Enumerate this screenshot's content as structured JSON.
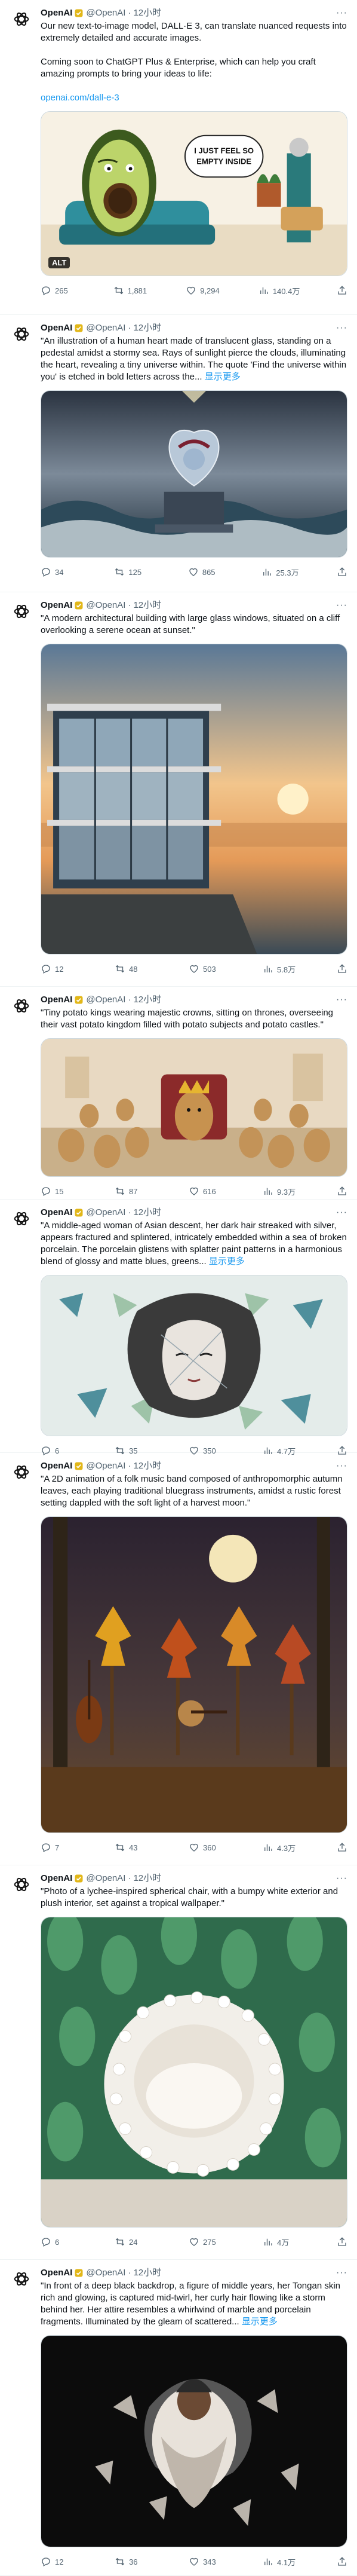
{
  "colors": {
    "accent": "#1d9bf0",
    "text_primary": "#0f1419",
    "text_secondary": "#536471",
    "border": "#eff3f4"
  },
  "tweets": [
    {
      "name": "OpenAI",
      "handle": "@OpenAI",
      "dot": "·",
      "time": "12小时",
      "more": "···",
      "paragraphs": [
        "Our new text-to-image model, DALL·E 3, can translate nuanced requests into extremely detailed and accurate images.",
        "Coming soon to ChatGPT Plus & Enterprise, which can help you craft amazing prompts to bring your ideas to life:"
      ],
      "link": "openai.com/dall-e-3",
      "image_alt": "ALT",
      "image_text": "I JUST FEEL SO EMPTY INSIDE",
      "stats": {
        "replies": "265",
        "retweets": "1,881",
        "likes": "9,294",
        "views": "140.4万"
      }
    },
    {
      "name": "OpenAI",
      "handle": "@OpenAI",
      "dot": "·",
      "time": "12小时",
      "more": "···",
      "quote": "\"An illustration of a human heart made of translucent glass, standing on a pedestal amidst a stormy sea. Rays of sunlight pierce the clouds, illuminating the heart, revealing a tiny universe within. The quote 'Find the universe within you' is etched in bold letters across the...",
      "showmore": "显示更多",
      "stats": {
        "replies": "34",
        "retweets": "125",
        "likes": "865",
        "views": "25.3万"
      }
    },
    {
      "name": "OpenAI",
      "handle": "@OpenAI",
      "dot": "·",
      "time": "12小时",
      "more": "···",
      "quote": "\"A modern architectural building with large glass windows, situated on a cliff overlooking a serene ocean at sunset.\"",
      "stats": {
        "replies": "12",
        "retweets": "48",
        "likes": "503",
        "views": "5.8万"
      }
    },
    {
      "name": "OpenAI",
      "handle": "@OpenAI",
      "dot": "·",
      "time": "12小时",
      "more": "···",
      "quote": "\"Tiny potato kings wearing majestic crowns, sitting on thrones, overseeing their vast potato kingdom filled with potato subjects and potato castles.\"",
      "stats": {
        "replies": "15",
        "retweets": "87",
        "likes": "616",
        "views": "9.3万"
      }
    },
    {
      "name": "OpenAI",
      "handle": "@OpenAI",
      "dot": "·",
      "time": "12小时",
      "more": "···",
      "quote": "\"A middle-aged woman of Asian descent, her dark hair streaked with silver, appears fractured and splintered, intricately embedded within a sea of broken porcelain. The porcelain glistens with splatter paint patterns in a harmonious blend of glossy and matte blues, greens...",
      "showmore": "显示更多",
      "stats": {
        "replies": "6",
        "retweets": "35",
        "likes": "350",
        "views": "4.7万"
      }
    },
    {
      "name": "OpenAI",
      "handle": "@OpenAI",
      "dot": "·",
      "time": "12小时",
      "more": "···",
      "quote": "\"A 2D animation of a folk music band composed of anthropomorphic autumn leaves, each playing traditional bluegrass instruments, amidst a rustic forest setting dappled with the soft light of a harvest moon.\"",
      "stats": {
        "replies": "7",
        "retweets": "43",
        "likes": "360",
        "views": "4.3万"
      }
    },
    {
      "name": "OpenAI",
      "handle": "@OpenAI",
      "dot": "·",
      "time": "12小时",
      "more": "···",
      "quote": "\"Photo of a lychee-inspired spherical chair, with a bumpy white exterior and plush interior, set against a tropical wallpaper.\"",
      "stats": {
        "replies": "6",
        "retweets": "24",
        "likes": "275",
        "views": "4万"
      }
    },
    {
      "name": "OpenAI",
      "handle": "@OpenAI",
      "dot": "·",
      "time": "12小时",
      "more": "···",
      "quote": "\"In front of a deep black backdrop, a figure of middle years, her Tongan skin rich and glowing, is captured mid-twirl, her curly hair flowing like a storm behind her. Her attire resembles a whirlwind of marble and porcelain fragments. Illuminated by the gleam of scattered...",
      "showmore": "显示更多",
      "stats": {
        "replies": "12",
        "retweets": "36",
        "likes": "343",
        "views": "4.1万"
      }
    }
  ]
}
